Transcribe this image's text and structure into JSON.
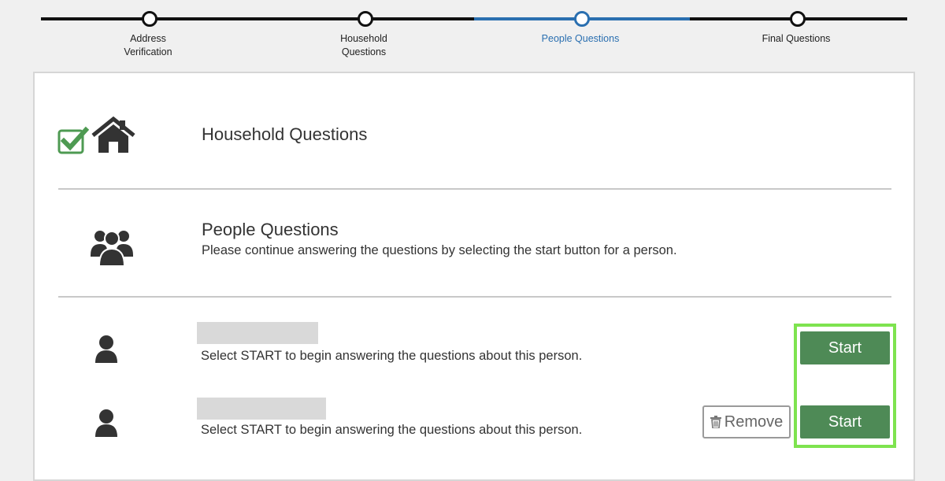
{
  "stepper": {
    "steps": [
      {
        "label": "Address\nVerification",
        "state": "complete"
      },
      {
        "label": "Household\nQuestions",
        "state": "complete"
      },
      {
        "label": "People Questions",
        "state": "current"
      },
      {
        "label": "Final Questions",
        "state": "pending"
      }
    ],
    "active_color": "#2a6fb0"
  },
  "household": {
    "title": "Household Questions",
    "icons": [
      "checkbox-checked-icon",
      "house-icon"
    ]
  },
  "people": {
    "title": "People Questions",
    "description": "Please continue answering the questions by selecting the start button for a person."
  },
  "persons": [
    {
      "prompt": "Select START to begin answering the questions about this person.",
      "start_label": "Start",
      "removable": false
    },
    {
      "prompt": "Select START to begin answering the questions about this person.",
      "start_label": "Start",
      "removable": true,
      "remove_label": "Remove"
    }
  ],
  "colors": {
    "button_green": "#4e8a56",
    "check_green": "#4e9a52",
    "highlight": "#7ee34f"
  }
}
